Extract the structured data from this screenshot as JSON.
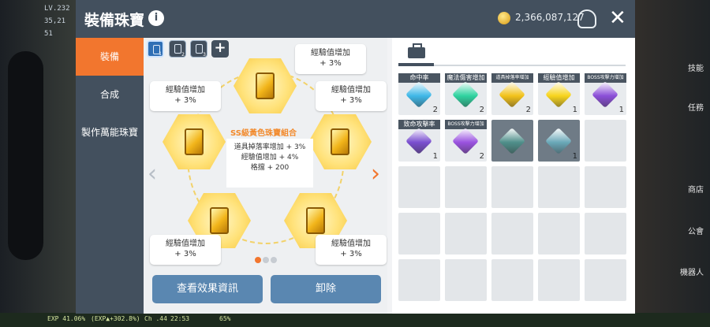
{
  "hud": {
    "level": "LV.232",
    "power": "35,21",
    "stat": "51",
    "exp": "EXP 41.06%",
    "exp_boost": "(EXP▲+302.8%)",
    "channel": "Ch .44",
    "time": "22:53",
    "battery": "65%",
    "right_labels": [
      "技能",
      "任務",
      "商店",
      "公會",
      "機器人"
    ]
  },
  "window": {
    "title": "裝備珠寶",
    "currency": "2,366,087,127",
    "info_symbol": "i",
    "close_symbol": "✕"
  },
  "side_tabs": [
    {
      "label": "裝備",
      "active": true
    },
    {
      "label": "合成",
      "active": false
    },
    {
      "label": "製作萬能珠寶",
      "active": false
    }
  ],
  "slots": [
    {
      "num": "1",
      "active": true
    },
    {
      "num": "2",
      "active": false
    },
    {
      "num": "3",
      "active": false
    }
  ],
  "slot_add_symbol": "+",
  "bubbles": {
    "top": "經驗值增加\n+ 3%",
    "upper_left": "經驗值增加\n+ 3%",
    "upper_right": "經驗值增加\n+ 3%",
    "lower_left": "經驗值增加\n+ 3%",
    "lower_right": "經驗值增加\n+ 3%"
  },
  "set": {
    "title": "SS級黃色珠寶組合",
    "line1": "道具掉落率增加 + 3%",
    "line2": "經驗值增加 + 4%",
    "line3": "格擋 + 200"
  },
  "nav": {
    "prev": "‹",
    "next": "›"
  },
  "buttons": {
    "view_effect": "查看效果資訊",
    "unequip": "卸除"
  },
  "inventory": [
    {
      "label": "命中率",
      "count": "2",
      "color": "#3fb8e8",
      "small": false,
      "dim": false
    },
    {
      "label": "魔法傷害增加",
      "count": "2",
      "color": "#2fd3a0",
      "small": false,
      "dim": false
    },
    {
      "label": "道具掉落率增加",
      "count": "2",
      "color": "#f2c21a",
      "small": true,
      "dim": false
    },
    {
      "label": "經驗值增加",
      "count": "1",
      "color": "#f7d41c",
      "small": false,
      "dim": false
    },
    {
      "label": "BOSS攻擊力增加",
      "count": "1",
      "color": "#8b4fd8",
      "small": true,
      "dim": false
    },
    {
      "label": "致命攻擊率",
      "count": "1",
      "color": "#7a4fd0",
      "small": false,
      "dim": false
    },
    {
      "label": "BOSS攻擊力增加",
      "count": "2",
      "color": "#9a52e0",
      "small": true,
      "dim": false
    },
    {
      "label": "",
      "count": "",
      "color": "#4f8f8a",
      "small": false,
      "dim": true
    },
    {
      "label": "",
      "count": "1",
      "color": "#6aa8b8",
      "small": false,
      "dim": true
    }
  ]
}
